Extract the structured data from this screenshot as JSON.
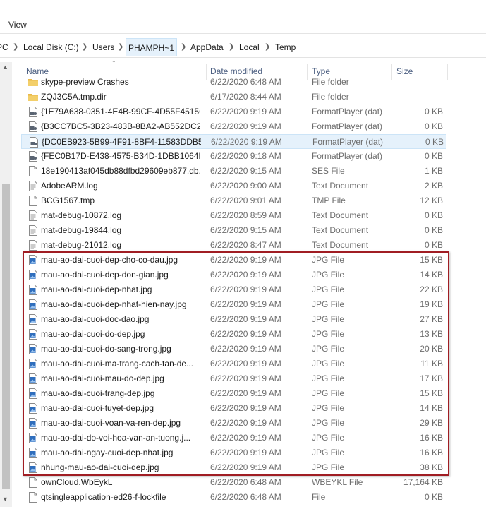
{
  "ribbon": {
    "view_tab": "View"
  },
  "breadcrumb": {
    "items": [
      "PC",
      "Local Disk (C:)",
      "Users",
      "PHAMPH~1",
      "AppData",
      "Local",
      "Temp"
    ]
  },
  "columns": {
    "name": "Name",
    "date": "Date modified",
    "type": "Type",
    "size": "Size"
  },
  "files": [
    {
      "name": "skype-preview Crashes",
      "date": "6/22/2020 6:48 AM",
      "type": "File folder",
      "size": "",
      "icon": "folder-icon"
    },
    {
      "name": "ZQJ3C5A.tmp.dir",
      "date": "6/17/2020 8:44 AM",
      "type": "File folder",
      "size": "",
      "icon": "folder-icon"
    },
    {
      "name": "{1E79A638-0351-4E4B-99CF-4D55F451561...",
      "date": "6/22/2020 9:19 AM",
      "type": "FormatPlayer (dat)",
      "size": "0 KB",
      "icon": "dat-file-icon"
    },
    {
      "name": "{B3CC7BC5-3B23-483B-8BA2-AB552DC2...",
      "date": "6/22/2020 9:19 AM",
      "type": "FormatPlayer (dat)",
      "size": "0 KB",
      "icon": "dat-file-icon"
    },
    {
      "name": "{DC0EB923-5B99-4F91-8BF4-11583DDB5...",
      "date": "6/22/2020 9:19 AM",
      "type": "FormatPlayer (dat)",
      "size": "0 KB",
      "icon": "dat-file-icon",
      "selected": true
    },
    {
      "name": "{FEC0B17D-E438-4575-B34D-1DBB1064E...",
      "date": "6/22/2020 9:18 AM",
      "type": "FormatPlayer (dat)",
      "size": "0 KB",
      "icon": "dat-file-icon"
    },
    {
      "name": "18e190413af045db88dfbd29609eb877.db....",
      "date": "6/22/2020 9:15 AM",
      "type": "SES File",
      "size": "1 KB",
      "icon": "generic-file-icon"
    },
    {
      "name": "AdobeARM.log",
      "date": "6/22/2020 9:00 AM",
      "type": "Text Document",
      "size": "2 KB",
      "icon": "text-file-icon"
    },
    {
      "name": "BCG1567.tmp",
      "date": "6/22/2020 9:01 AM",
      "type": "TMP File",
      "size": "12 KB",
      "icon": "generic-file-icon"
    },
    {
      "name": "mat-debug-10872.log",
      "date": "6/22/2020 8:59 AM",
      "type": "Text Document",
      "size": "0 KB",
      "icon": "text-file-icon"
    },
    {
      "name": "mat-debug-19844.log",
      "date": "6/22/2020 9:15 AM",
      "type": "Text Document",
      "size": "0 KB",
      "icon": "text-file-icon"
    },
    {
      "name": "mat-debug-21012.log",
      "date": "6/22/2020 8:47 AM",
      "type": "Text Document",
      "size": "0 KB",
      "icon": "text-file-icon"
    },
    {
      "name": "mau-ao-dai-cuoi-dep-cho-co-dau.jpg",
      "date": "6/22/2020 9:19 AM",
      "type": "JPG File",
      "size": "15 KB",
      "icon": "image-file-icon"
    },
    {
      "name": "mau-ao-dai-cuoi-dep-don-gian.jpg",
      "date": "6/22/2020 9:19 AM",
      "type": "JPG File",
      "size": "14 KB",
      "icon": "image-file-icon"
    },
    {
      "name": "mau-ao-dai-cuoi-dep-nhat.jpg",
      "date": "6/22/2020 9:19 AM",
      "type": "JPG File",
      "size": "22 KB",
      "icon": "image-file-icon"
    },
    {
      "name": "mau-ao-dai-cuoi-dep-nhat-hien-nay.jpg",
      "date": "6/22/2020 9:19 AM",
      "type": "JPG File",
      "size": "19 KB",
      "icon": "image-file-icon"
    },
    {
      "name": "mau-ao-dai-cuoi-doc-dao.jpg",
      "date": "6/22/2020 9:19 AM",
      "type": "JPG File",
      "size": "27 KB",
      "icon": "image-file-icon"
    },
    {
      "name": "mau-ao-dai-cuoi-do-dep.jpg",
      "date": "6/22/2020 9:19 AM",
      "type": "JPG File",
      "size": "13 KB",
      "icon": "image-file-icon"
    },
    {
      "name": "mau-ao-dai-cuoi-do-sang-trong.jpg",
      "date": "6/22/2020 9:19 AM",
      "type": "JPG File",
      "size": "20 KB",
      "icon": "image-file-icon"
    },
    {
      "name": "mau-ao-dai-cuoi-ma-trang-cach-tan-de...",
      "date": "6/22/2020 9:19 AM",
      "type": "JPG File",
      "size": "11 KB",
      "icon": "image-file-icon"
    },
    {
      "name": "mau-ao-dai-cuoi-mau-do-dep.jpg",
      "date": "6/22/2020 9:19 AM",
      "type": "JPG File",
      "size": "17 KB",
      "icon": "image-file-icon"
    },
    {
      "name": "mau-ao-dai-cuoi-trang-dep.jpg",
      "date": "6/22/2020 9:19 AM",
      "type": "JPG File",
      "size": "15 KB",
      "icon": "image-file-icon"
    },
    {
      "name": "mau-ao-dai-cuoi-tuyet-dep.jpg",
      "date": "6/22/2020 9:19 AM",
      "type": "JPG File",
      "size": "14 KB",
      "icon": "image-file-icon"
    },
    {
      "name": "mau-ao-dai-cuoi-voan-va-ren-dep.jpg",
      "date": "6/22/2020 9:19 AM",
      "type": "JPG File",
      "size": "29 KB",
      "icon": "image-file-icon"
    },
    {
      "name": "mau-ao-dai-do-voi-hoa-van-an-tuong.j...",
      "date": "6/22/2020 9:19 AM",
      "type": "JPG File",
      "size": "16 KB",
      "icon": "image-file-icon"
    },
    {
      "name": "mau-ao-dai-ngay-cuoi-dep-nhat.jpg",
      "date": "6/22/2020 9:19 AM",
      "type": "JPG File",
      "size": "16 KB",
      "icon": "image-file-icon"
    },
    {
      "name": "nhung-mau-ao-dai-cuoi-dep.jpg",
      "date": "6/22/2020 9:19 AM",
      "type": "JPG File",
      "size": "38 KB",
      "icon": "image-file-icon"
    },
    {
      "name": "ownCloud.WbEykL",
      "date": "6/22/2020 6:48 AM",
      "type": "WBEYKL File",
      "size": "17,164 KB",
      "icon": "generic-file-icon"
    },
    {
      "name": "qtsingleapplication-ed26-f-lockfile",
      "date": "6/22/2020 6:48 AM",
      "type": "File",
      "size": "0 KB",
      "icon": "generic-file-icon"
    }
  ],
  "colors": {
    "highlight_border": "#a01d23",
    "selection_bg": "#e5f1fb",
    "header_text": "#4d6082",
    "folder": "#e8b84a",
    "image_icon": "#2f6ebd"
  }
}
